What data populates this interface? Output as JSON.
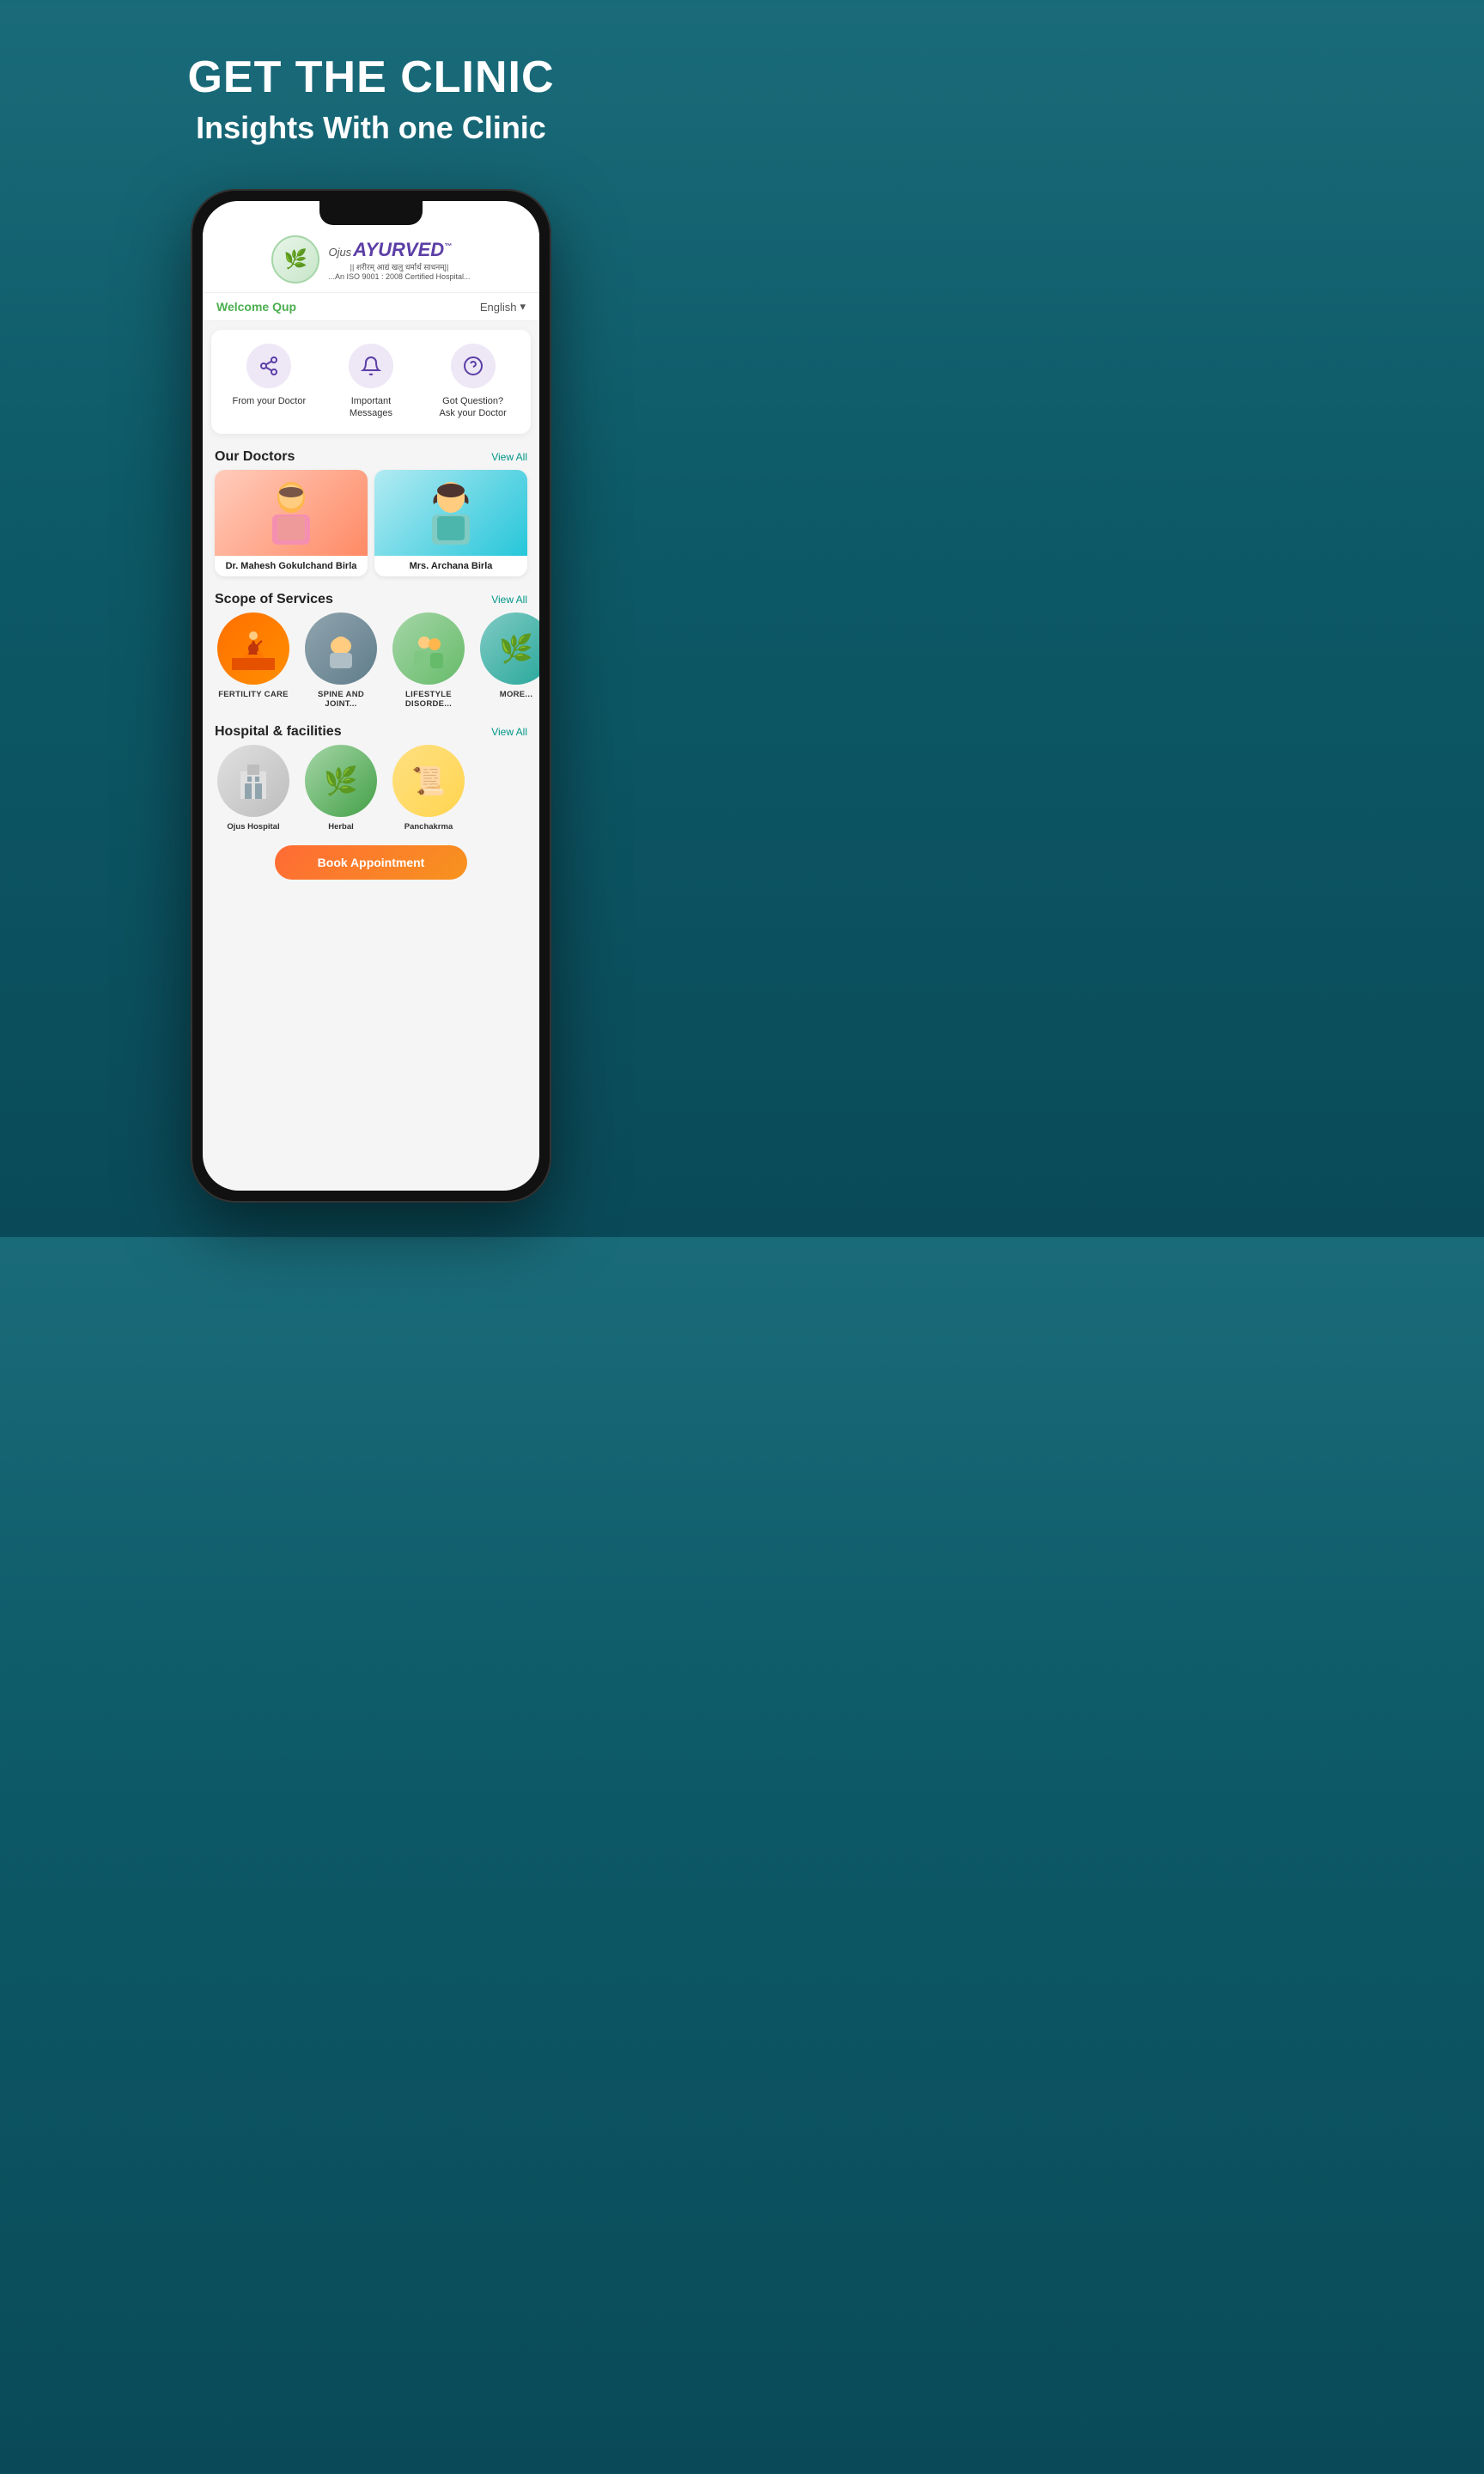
{
  "hero": {
    "title": "GET THE CLINIC",
    "subtitle": "Insights With one Clinic"
  },
  "app": {
    "logo": {
      "icon": "🌿",
      "brand_prefix": "Ojus ",
      "brand_name": "AYURVED",
      "tm": "™",
      "tagline1": "|| शरीरम् आद्यं खलु धर्मार्थ साधनम्||",
      "tagline2": "...An ISO 9001 : 2008 Certified Hospital..."
    },
    "welcome": {
      "text": "Welcome Qup",
      "language": "English",
      "lang_icon": "▾"
    },
    "quick_actions": [
      {
        "id": "from-doctor",
        "label": "From your Doctor",
        "icon": "⇈"
      },
      {
        "id": "important-messages",
        "label": "Important Messages",
        "icon": "🔔"
      },
      {
        "id": "ask-doctor",
        "label": "Got Question? Ask your Doctor",
        "icon": "?"
      }
    ],
    "doctors_section": {
      "title": "Our Doctors",
      "view_all": "View All",
      "doctors": [
        {
          "name": "Dr. Mahesh Gokulchand Birla",
          "gender": "male",
          "emoji": "👨‍⚕️"
        },
        {
          "name": "Mrs. Archana Birla",
          "gender": "female",
          "emoji": "👩‍⚕️"
        }
      ]
    },
    "services_section": {
      "title": "Scope of Services",
      "view_all": "View All",
      "services": [
        {
          "label": "FERTILITY CARE",
          "emoji": "👨‍👧"
        },
        {
          "label": "SPINE AND JOINT...",
          "emoji": "🧖"
        },
        {
          "label": "LIFESTYLE DISORDE...",
          "emoji": "👫"
        },
        {
          "label": "MORE...",
          "emoji": "🌿"
        }
      ]
    },
    "hospital_section": {
      "title": "Hospital & facilities",
      "view_all": "View All",
      "facilities": [
        {
          "label": "Ojus Hospital",
          "emoji": "🏥"
        },
        {
          "label": "Herbal",
          "emoji": "🌿"
        },
        {
          "label": "Panchakrma",
          "emoji": "📜"
        }
      ]
    },
    "book_button": "Book Appointment"
  }
}
